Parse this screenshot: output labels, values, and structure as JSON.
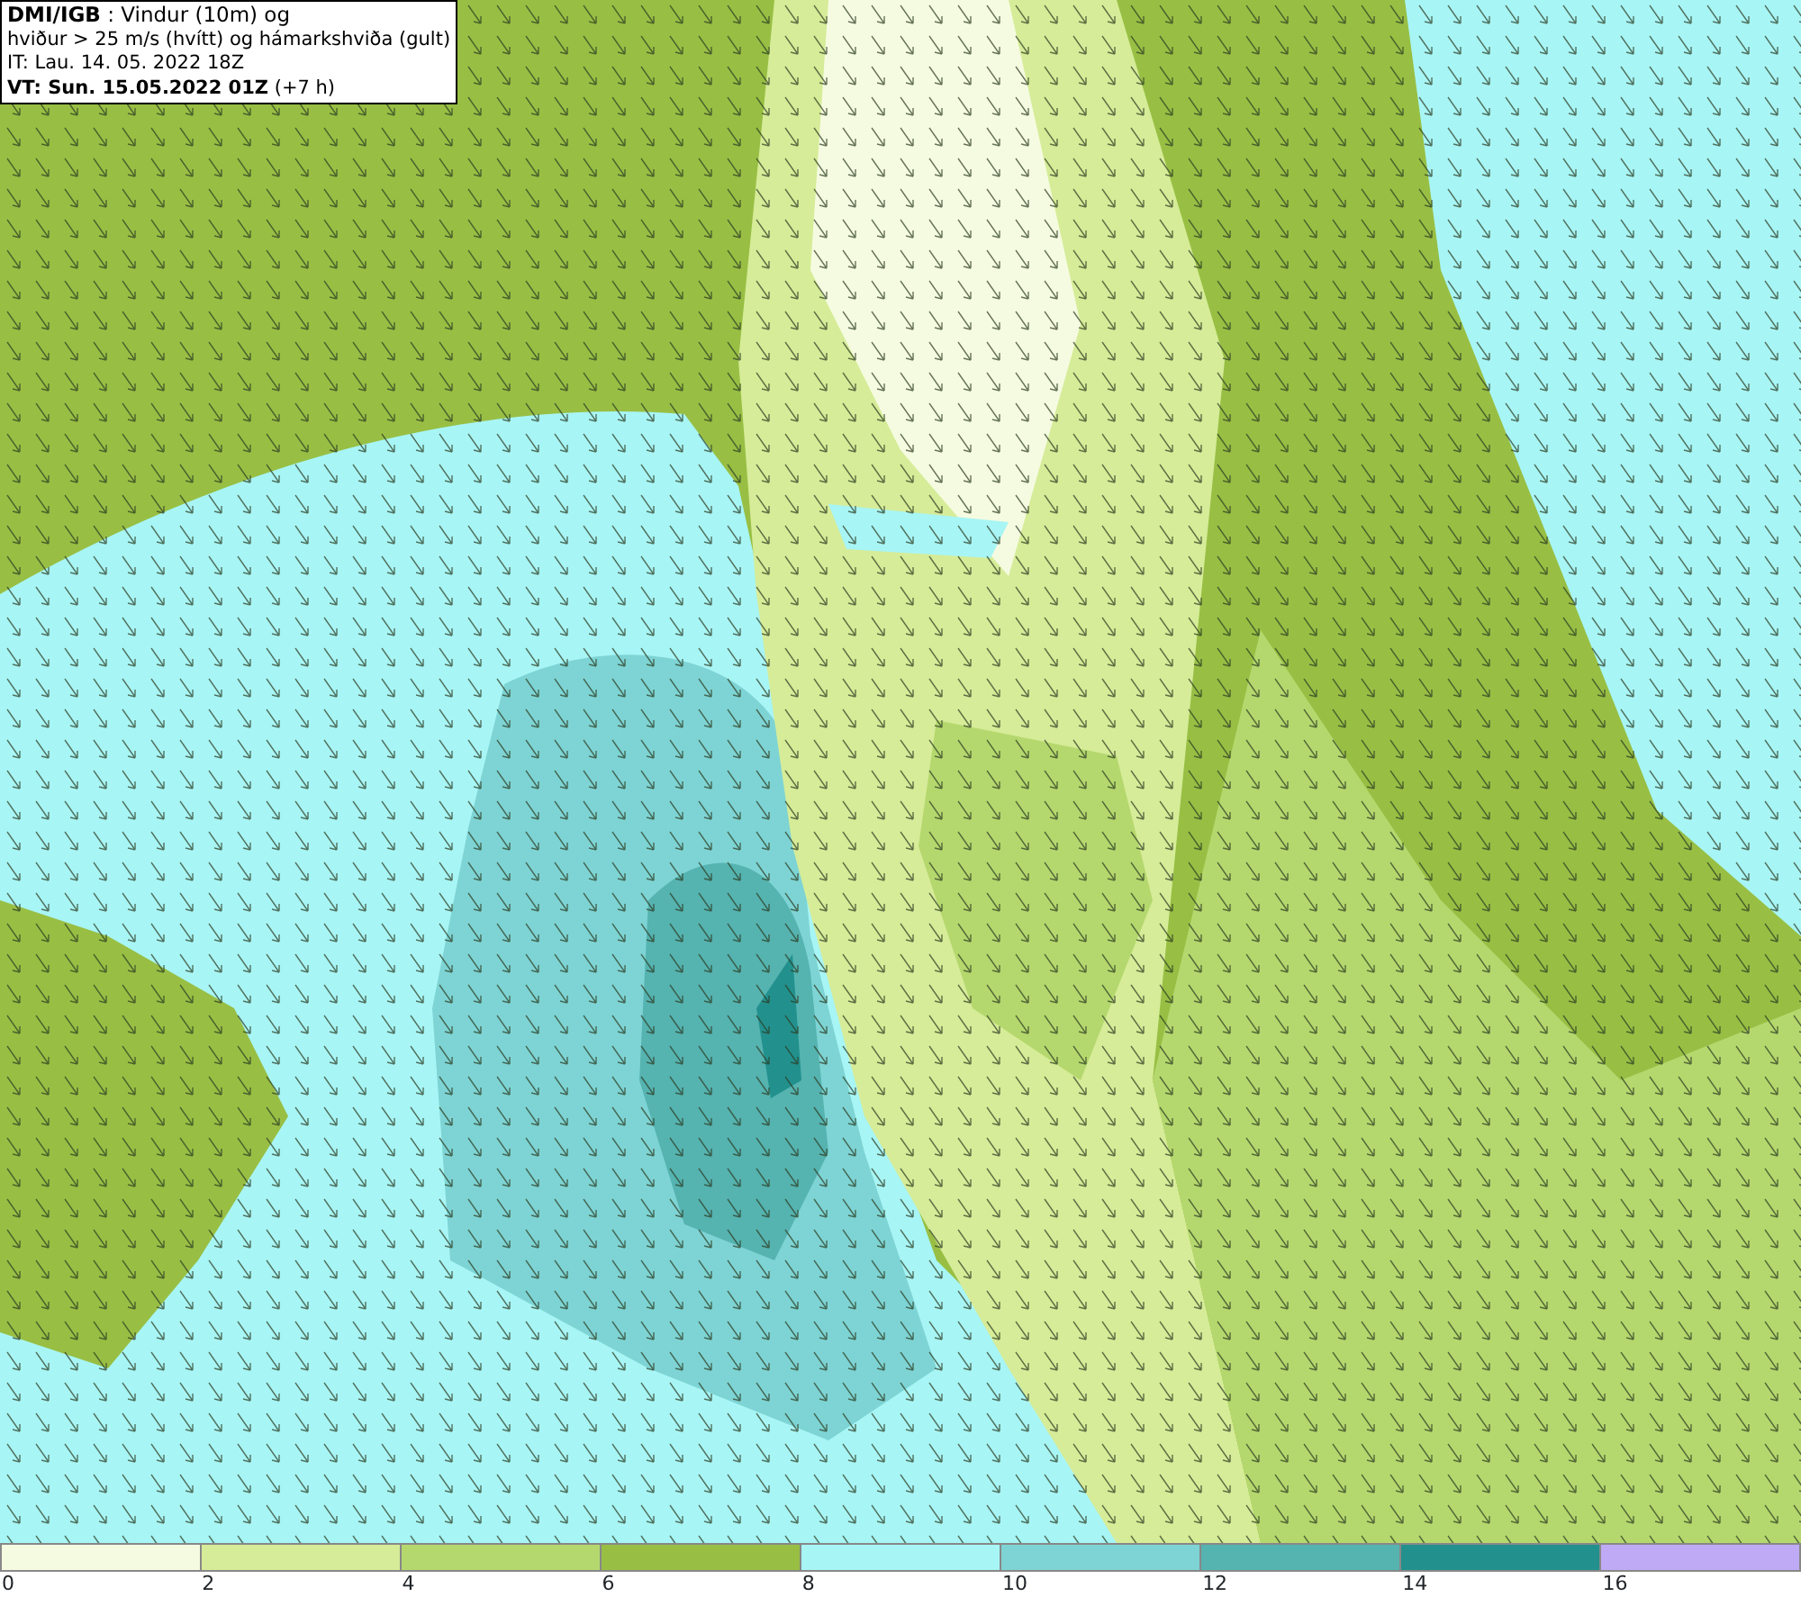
{
  "info_box": {
    "lines": [
      {
        "text": "**DMI/IGB** : Vindur (10m) og"
      },
      {
        "text": "hviður > 25 m/s (hvítt) og hámarkshviða (gult)"
      },
      {
        "text": "IT: Lau. 14. 05. 2022 18Z"
      },
      {
        "text": "**VT: Sun. 15.05.2022 01Z** (+7 h)"
      }
    ]
  },
  "legend": {
    "bins": [
      {
        "color": "#f5fbe0"
      },
      {
        "color": "#d6ec98"
      },
      {
        "color": "#b5d86e"
      },
      {
        "color": "#98bf44"
      },
      {
        "color": "#a8f5f5"
      },
      {
        "color": "#7ed4d4"
      },
      {
        "color": "#55b3b0"
      },
      {
        "color": "#22918e"
      },
      {
        "color": "#bfaaf5"
      }
    ],
    "ticks": [
      "0",
      "2",
      "4",
      "6",
      "8",
      "10",
      "12",
      "14",
      "16"
    ]
  }
}
